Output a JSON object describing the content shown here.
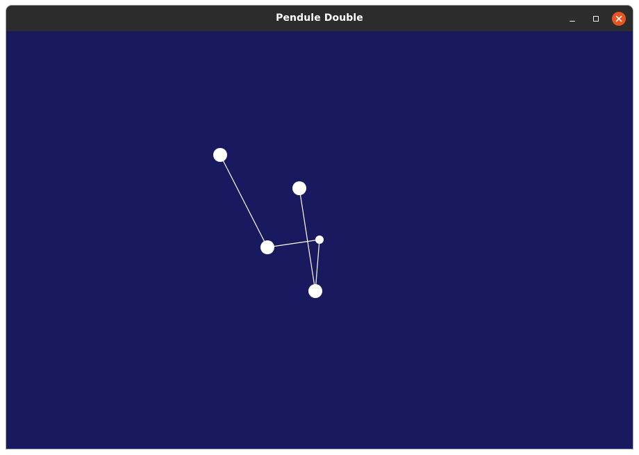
{
  "window": {
    "title": "Pendule Double",
    "controls": {
      "minimize_icon": "minimize-icon",
      "maximize_icon": "maximize-icon",
      "close_icon": "close-icon"
    },
    "colors": {
      "titlebar": "#2c2c2c",
      "canvas_background": "#191960",
      "close_button": "#e95420",
      "pendulum": "#ffffff"
    }
  }
}
